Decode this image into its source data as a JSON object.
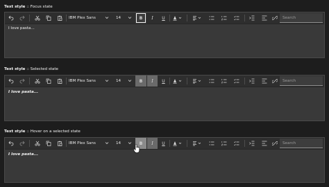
{
  "sections": [
    {
      "caption_bold": "Text style",
      "caption_rest": " :: Focus state",
      "font_family": "IBM Plex Sans",
      "font_size": "14",
      "search_placeholder": "Search",
      "content": "I love pasta..."
    },
    {
      "caption_bold": "Text style",
      "caption_rest": " :: Selected state",
      "font_family": "IBM Plex Sans",
      "font_size": "14",
      "search_placeholder": "Search",
      "content": "I love pasta..."
    },
    {
      "caption_bold": "Text style",
      "caption_rest": " :: Hover on a selected state",
      "font_family": "IBM Plex Sans",
      "font_size": "14",
      "search_placeholder": "Search",
      "content": "I love pasta..."
    }
  ],
  "toolbar_labels": {
    "bold": "B",
    "italic": "I",
    "underline": "U"
  },
  "icons": [
    "undo-icon",
    "redo-icon",
    "cut-icon",
    "copy-icon",
    "paste-icon",
    "chevron-down-icon",
    "text-color-icon",
    "align-icon",
    "bullet-list-icon",
    "numbered-list-icon",
    "checklist-icon",
    "indent-icon",
    "outdent-icon",
    "link-icon",
    "pointer-cursor-icon"
  ],
  "colors": {
    "background": "#1d1d1d",
    "editor": "#393939",
    "toolbar": "#2e2e2e",
    "focus_ring": "#f4f4f4"
  }
}
